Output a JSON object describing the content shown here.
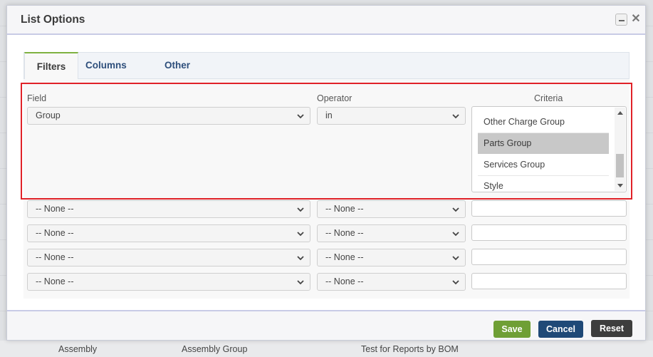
{
  "dialog": {
    "title": "List Options"
  },
  "tabs": [
    {
      "label": "Filters",
      "active": true
    },
    {
      "label": "Columns",
      "active": false
    },
    {
      "label": "Other",
      "active": false
    }
  ],
  "filters": {
    "headers": {
      "field": "Field",
      "operator": "Operator",
      "criteria": "Criteria"
    },
    "first_row": {
      "field": "Group",
      "operator": "in",
      "criteria_options": [
        "Other Charge Group",
        "Parts Group",
        "Services Group",
        "Style"
      ],
      "criteria_selected": "Parts Group"
    },
    "empty_rows": [
      {
        "field": "-- None --",
        "operator": "-- None --",
        "criteria": ""
      },
      {
        "field": "-- None --",
        "operator": "-- None --",
        "criteria": ""
      },
      {
        "field": "-- None --",
        "operator": "-- None --",
        "criteria": ""
      },
      {
        "field": "-- None --",
        "operator": "-- None --",
        "criteria": ""
      }
    ]
  },
  "buttons": {
    "save": "Save",
    "cancel": "Cancel",
    "reset": "Reset"
  },
  "background": {
    "footer_cells": [
      "Assembly",
      "Assembly Group",
      "Test for Reports by BOM"
    ]
  },
  "colors": {
    "highlight": "#e02228",
    "tab_active_accent": "#7fb241",
    "save": "#6f9f35",
    "cancel": "#1f4977",
    "reset": "#3d3d3d"
  },
  "icons": {
    "minimize": "minimize-icon",
    "close": "close-icon",
    "dropdown": "chevron-down-icon"
  }
}
